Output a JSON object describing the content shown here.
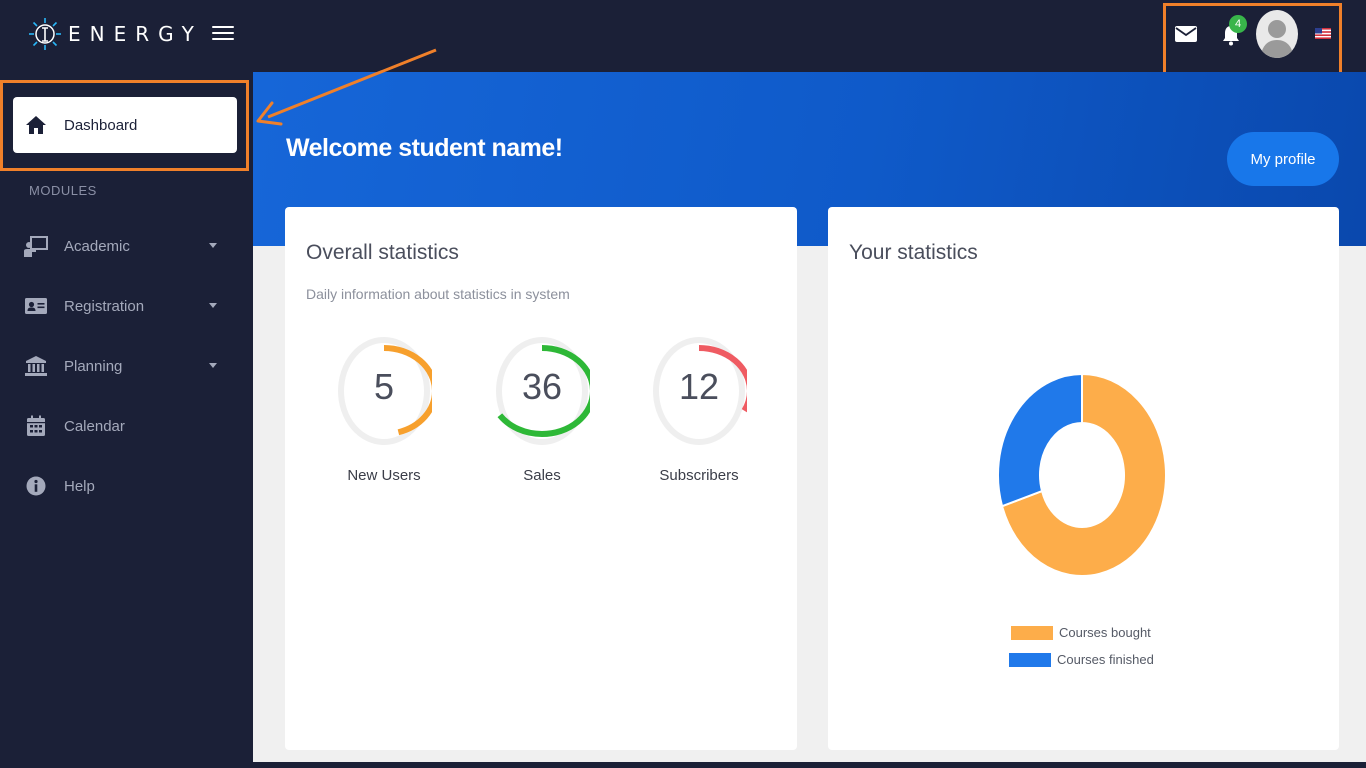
{
  "app": {
    "name": "ENERGY"
  },
  "topbar": {
    "notifications_count": "4",
    "icons": [
      "mail-icon",
      "bell-icon",
      "avatar",
      "us-flag-icon"
    ]
  },
  "sidebar": {
    "active": {
      "label": "Dashboard",
      "icon": "home-icon"
    },
    "section_title": "MODULES",
    "items": [
      {
        "label": "Academic",
        "icon": "presentation-icon",
        "has_submenu": true
      },
      {
        "label": "Registration",
        "icon": "id-card-icon",
        "has_submenu": true
      },
      {
        "label": "Planning",
        "icon": "bank-icon",
        "has_submenu": true
      },
      {
        "label": "Calendar",
        "icon": "calendar-icon",
        "has_submenu": false
      },
      {
        "label": "Help",
        "icon": "info-icon",
        "has_submenu": false
      }
    ]
  },
  "main": {
    "welcome": "Welcome student name!",
    "profile_button": "My profile",
    "overall": {
      "title": "Overall statistics",
      "subtitle": "Daily information about statistics in system",
      "gauges": [
        {
          "value": "5",
          "label": "New Users",
          "fraction": 0.45,
          "color": "#f7a02d"
        },
        {
          "value": "36",
          "label": "Sales",
          "fraction": 0.66,
          "color": "#2eb837"
        },
        {
          "value": "12",
          "label": "Subscribers",
          "fraction": 0.32,
          "color": "#ef5b62"
        }
      ]
    },
    "your_stats": {
      "title": "Your statistics"
    }
  },
  "chart_data": {
    "type": "pie",
    "labels": [
      "Courses bought",
      "Courses finished"
    ],
    "values": [
      70,
      30
    ],
    "colors": [
      "#fdad4a",
      "#2079ea"
    ],
    "legend": "bottom"
  },
  "colors": {
    "sidebar_bg": "#1b2037",
    "accent_blue": "#1666d8",
    "annotation_orange": "#f0802a"
  }
}
